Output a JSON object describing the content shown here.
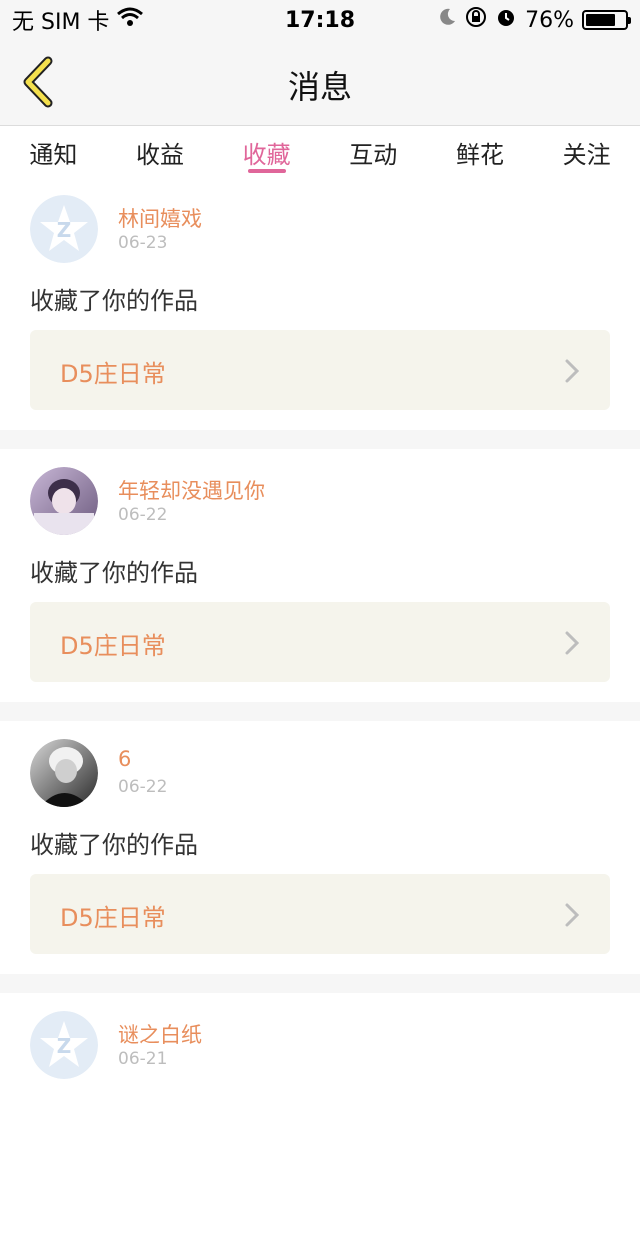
{
  "status": {
    "carrier": "无 SIM 卡",
    "time": "17:18",
    "battery_text": "76%",
    "battery_level": 0.76,
    "icons": [
      "wifi-icon",
      "moon-icon",
      "rotation-lock-icon",
      "alarm-icon",
      "battery-icon"
    ]
  },
  "header": {
    "title": "消息"
  },
  "tabs": [
    {
      "label": "通知"
    },
    {
      "label": "收益"
    },
    {
      "label": "收藏"
    },
    {
      "label": "互动"
    },
    {
      "label": "鲜花"
    },
    {
      "label": "关注"
    }
  ],
  "active_tab": "收藏",
  "items": [
    {
      "user": "林间嬉戏",
      "date": "06-23",
      "action": "收藏了你的作品",
      "work": "D5庄日常",
      "avatar": "default-avatar"
    },
    {
      "user": "年轻却没遇见你",
      "date": "06-22",
      "action": "收藏了你的作品",
      "work": "D5庄日常",
      "avatar": "photo-avatar-purple"
    },
    {
      "user": "6",
      "date": "06-22",
      "action": "收藏了你的作品",
      "work": "D5庄日常",
      "avatar": "photo-avatar-mono"
    },
    {
      "user": "谜之白纸",
      "date": "06-21",
      "action": "",
      "work": "",
      "avatar": "default-avatar"
    }
  ],
  "colors": {
    "accent_pink": "#e0669a",
    "username_orange": "#e88e5c",
    "work_card_bg": "#f5f4ec",
    "back_icon_yellow": "#f4e04d"
  }
}
